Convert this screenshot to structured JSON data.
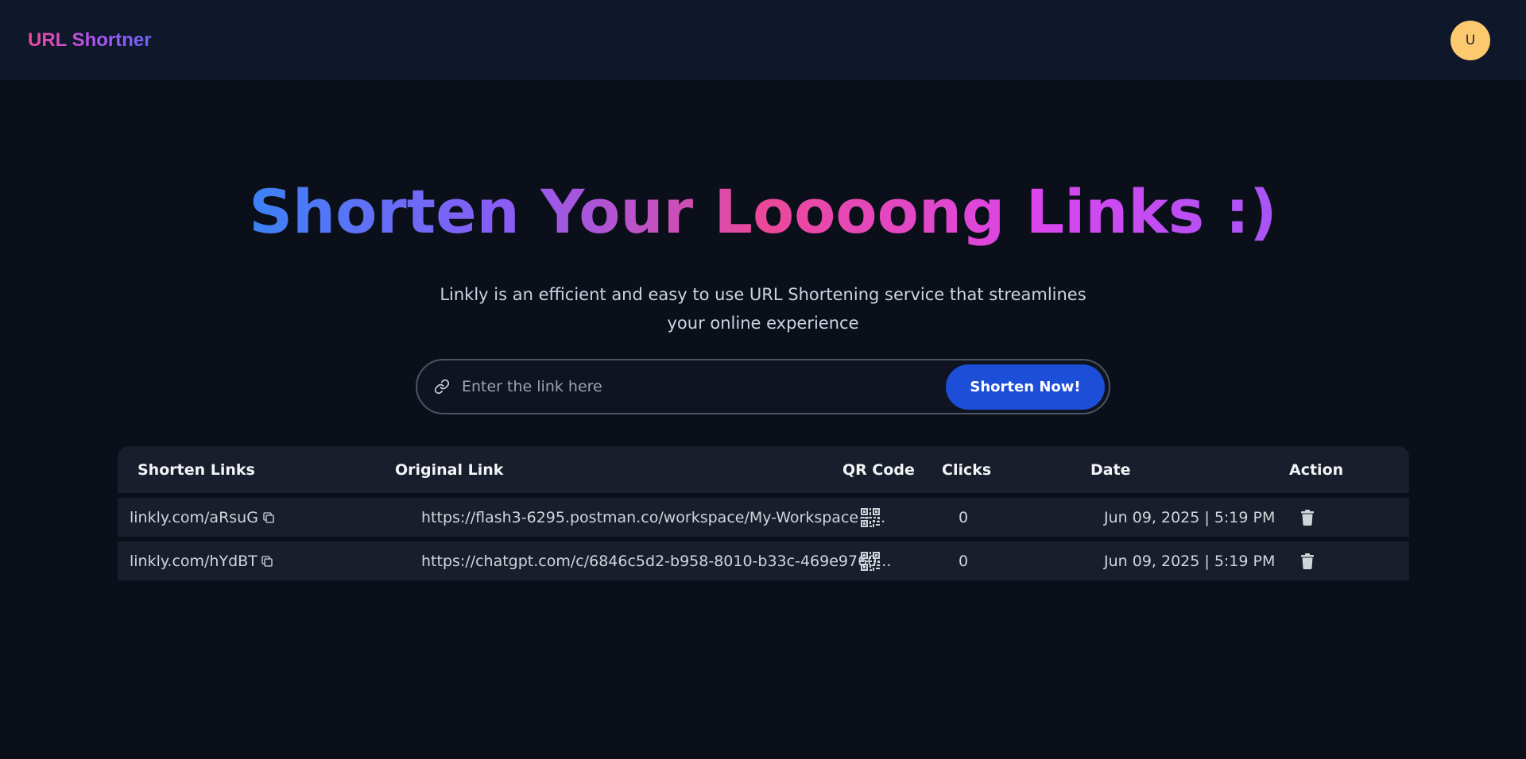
{
  "app": {
    "logo": "URL Shortner",
    "avatar_initial": "U"
  },
  "hero": {
    "title": "Shorten Your Loooong Links :)",
    "subtitle": "Linkly is an efficient and easy to use URL Shortening service that streamlines your online experience"
  },
  "form": {
    "placeholder": "Enter the link here",
    "value": "",
    "button_label": "Shorten Now!",
    "link_icon": "link-icon"
  },
  "table": {
    "headers": {
      "short": "Shorten Links",
      "original": "Original Link",
      "qr": "QR Code",
      "clicks": "Clicks",
      "date": "Date",
      "action": "Action"
    },
    "rows": [
      {
        "short": "linkly.com/aRsuG",
        "original": "https://flash3-6295.postman.co/workspace/My-Workspace~...",
        "clicks": "0",
        "date": "Jun 09, 2025 | 5:19 PM",
        "copy_icon": "copy-icon",
        "qr_icon": "qr-code-icon",
        "action_icon": "trash-icon"
      },
      {
        "short": "linkly.com/hYdBT",
        "original": "https://chatgpt.com/c/6846c5d2-b958-8010-b33c-469e9760...",
        "clicks": "0",
        "date": "Jun 09, 2025 | 5:19 PM",
        "copy_icon": "copy-icon",
        "qr_icon": "qr-code-icon",
        "action_icon": "trash-icon"
      }
    ]
  },
  "colors": {
    "background": "#0b0f19",
    "navbar": "#0f172a",
    "accent_blue": "#1d4ed8",
    "avatar": "#fcc96f",
    "gradient": [
      "#3b82f6",
      "#8b5cf6",
      "#ec4899",
      "#d946ef",
      "#a855f7"
    ]
  }
}
